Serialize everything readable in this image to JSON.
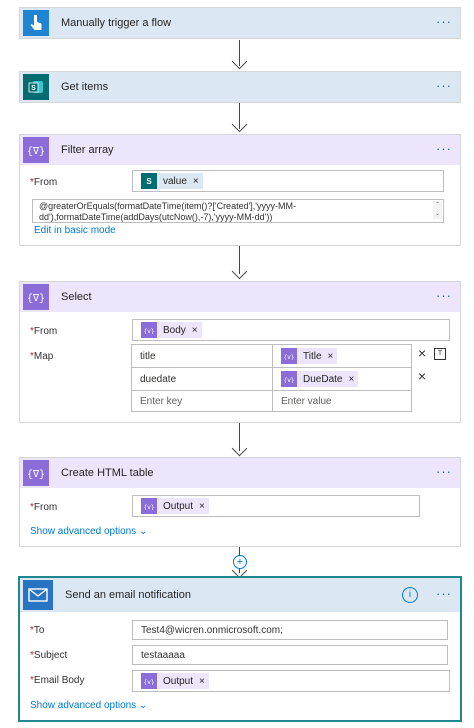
{
  "steps": {
    "trigger": {
      "title": "Manually trigger a flow",
      "icon": "hand-touch-icon"
    },
    "get_items": {
      "title": "Get items",
      "icon": "sharepoint-icon"
    },
    "filter": {
      "title": "Filter array",
      "icon": "data-operation-icon",
      "from_label": "From",
      "from_token": "value",
      "expression_line1": "@greaterOrEquals(formatDateTime(item()?['Created'],'yyyy-MM-",
      "expression_line2": "dd'),formatDateTime(addDays(utcNow(),-7),'yyyy-MM-dd'))",
      "edit_link": "Edit in basic mode"
    },
    "select": {
      "title": "Select",
      "icon": "data-operation-icon",
      "from_label": "From",
      "from_token": "Body",
      "map_label": "Map",
      "rows": [
        {
          "key": "title",
          "value": "Title"
        },
        {
          "key": "duedate",
          "value": "DueDate"
        }
      ],
      "key_placeholder": "Enter key",
      "value_placeholder": "Enter value"
    },
    "html_table": {
      "title": "Create HTML table",
      "icon": "data-operation-icon",
      "from_label": "From",
      "from_token": "Output",
      "advanced_link": "Show advanced options"
    },
    "email": {
      "title": "Send an email notification",
      "icon": "mail-icon",
      "to_label": "To",
      "to_value": "Test4@wicren.onmicrosoft.com;",
      "subject_label": "Subject",
      "subject_value": "testaaaaa",
      "body_label": "Email Body",
      "body_token": "Output",
      "advanced_link": "Show advanced options"
    }
  },
  "more_glyph": "···",
  "required_mark": "*",
  "token_close": "×",
  "colors": {
    "accent": "#0078d4",
    "purple": "#8c6cd9",
    "sharepoint": "#036c70"
  }
}
